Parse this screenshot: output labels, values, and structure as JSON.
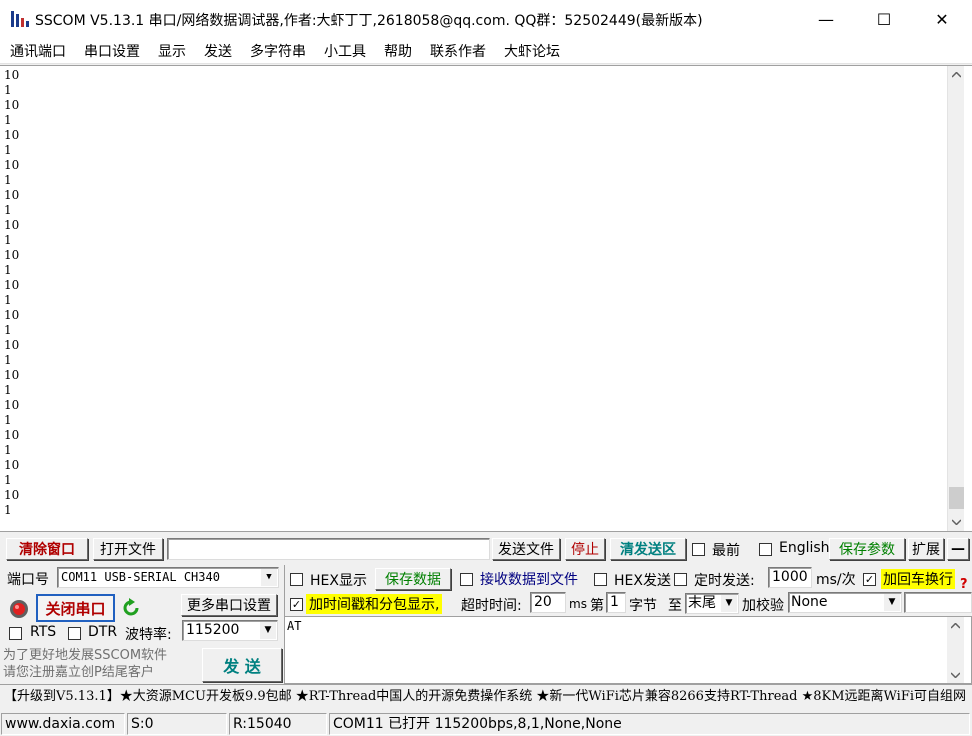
{
  "window": {
    "title": "SSCOM V5.13.1 串口/网络数据调试器,作者:大虾丁丁,2618058@qq.com. QQ群：52502449(最新版本)",
    "minimize": "—",
    "maximize": "☐",
    "close": "✕"
  },
  "menu": [
    "通讯端口",
    "串口设置",
    "显示",
    "发送",
    "多字符串",
    "小工具",
    "帮助",
    "联系作者",
    "大虾论坛"
  ],
  "receive": {
    "lines": [
      "10",
      "1",
      "10",
      "1",
      "10",
      "1",
      "10",
      "1",
      "10",
      "1",
      "10",
      "1",
      "10",
      "1",
      "10",
      "1",
      "10",
      "1",
      "10",
      "1",
      "10",
      "1",
      "10",
      "1",
      "10",
      "1",
      "10",
      "1",
      "10",
      "1",
      "10",
      "1",
      "10",
      "1",
      "10",
      "1",
      "10",
      "1",
      "10",
      "1",
      "10",
      "1",
      "10",
      "1",
      "10",
      "1",
      "10",
      "1",
      "10",
      "1",
      "10",
      "1",
      "10",
      "1",
      "10",
      "1",
      "10",
      "1",
      "10",
      "1",
      "10",
      "1",
      "10",
      "1",
      "10",
      "1",
      "10",
      "1",
      "10",
      "1",
      "10",
      "1",
      "10",
      "1",
      "10",
      "1",
      "10",
      "1",
      "10",
      "1",
      "10",
      "1",
      "10",
      "1",
      "10",
      "1",
      "10",
      "1",
      "10",
      "1",
      "10",
      "1",
      "10",
      "1",
      "10",
      "1",
      "10",
      "1",
      "10",
      "1",
      "10",
      "1",
      "10",
      "1",
      "10",
      "1",
      "10",
      "1",
      "10",
      "1",
      "10",
      "1",
      "10",
      "1",
      "10",
      "1",
      "10",
      "1",
      "10",
      "1",
      "10",
      "1",
      "10",
      "1",
      "10",
      "1",
      "10",
      "1",
      "10",
      "1",
      "10",
      "1",
      "10",
      "1",
      "10",
      "1",
      "10",
      "1",
      "10",
      "1",
      "10",
      "1",
      "10",
      "1",
      "10",
      "1",
      "10",
      "1",
      "10",
      "1",
      "10",
      "1",
      "10",
      "1",
      "10",
      "1",
      "10",
      "1"
    ]
  },
  "toolbar": {
    "clear_window": "清除窗口",
    "open_file": "打开文件",
    "file_path": "",
    "send_file": "发送文件",
    "stop": "停止",
    "clear_send": "清发送区",
    "topmost_label": "最前",
    "english_label": "English",
    "save_params": "保存参数",
    "expand": "扩展",
    "collapse": "—"
  },
  "port": {
    "port_label": "端口号",
    "port_value": "COM11 USB-SERIAL CH340",
    "close_port": "关闭串口",
    "more_settings": "更多串口设置",
    "rts_label": "RTS",
    "dtr_label": "DTR",
    "baud_label": "波特率:",
    "baud_value": "115200"
  },
  "options": {
    "hex_display": "HEX显示",
    "save_data": "保存数据",
    "recv_to_file": "接收数据到文件",
    "hex_send": "HEX发送",
    "timed_send": "定时发送:",
    "interval_value": "1000",
    "interval_unit": "ms/次",
    "add_crlf": "加回车换行",
    "add_timestamp": "加时间戳和分包显示,",
    "timeout_label": "超时时间:",
    "timeout_value": "20",
    "timeout_unit": "ms",
    "byte_from_label": "第",
    "byte_from_value": "1",
    "byte_unit_label": "字节",
    "to_label": "至",
    "to_value": "末尾",
    "checksum_label": "加校验",
    "checksum_value": "None",
    "help_mark": "?"
  },
  "send": {
    "text": "AT",
    "send_button": "发  送",
    "promo": "为了更好地发展SSCOM软件\n请您注册嘉立创P结尾客户"
  },
  "ticker": "【升级到V5.13.1】★大资源MCU开发板9.9包邮 ★RT-Thread中国人的开源免费操作系统 ★新一代WiFi芯片兼容8266支持RT-Thread ★8KM远距离WiFi可自组网",
  "statusbar": {
    "website": "www.daxia.com",
    "sent": "S:0",
    "received": "R:15040",
    "port_status": "COM11 已打开  115200bps,8,1,None,None"
  },
  "colors": {
    "red_button_text": "#b00000",
    "teal_button_text": "#008080",
    "highlight": "#ffff00"
  }
}
